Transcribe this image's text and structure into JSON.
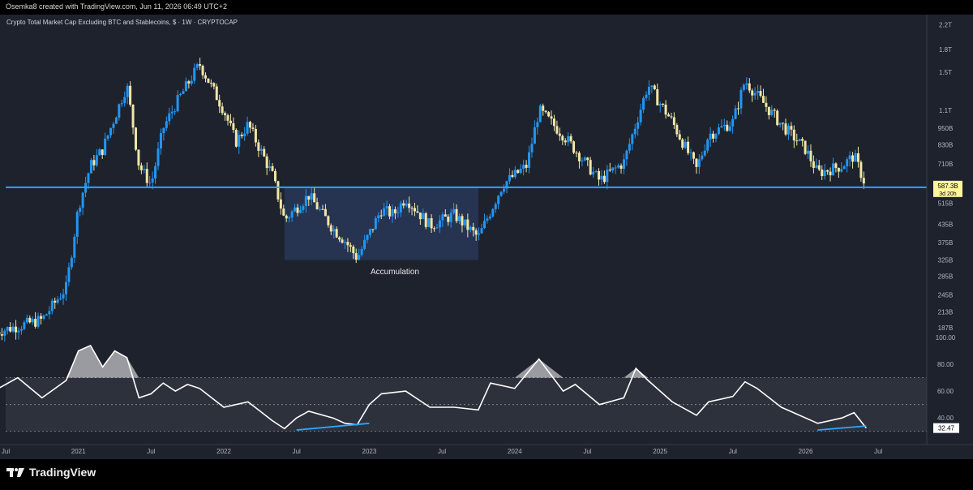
{
  "header": {
    "caption": "Osemka8 created with TradingView.com, Jun 11, 2026 06:49 UTC+2"
  },
  "chart_title": "Crypto Total Market Cap Excluding BTC and Stablecoins, $ · 1W · CRYPTOCAP",
  "footer": {
    "brand": "TradingView",
    "logo_icon": "tradingview-logo-icon"
  },
  "colors": {
    "background": "#1e222d",
    "up": "#2196f3",
    "down": "#f0e6a6",
    "support_line": "#2ba5ff",
    "rsi_line": "#ffffff",
    "zone": "#2a3a5e",
    "price_badge": "#fff59d"
  },
  "annotations": {
    "zone_label": "Accumulation"
  },
  "price_axis": {
    "ticks": [
      "2.2T",
      "1.8T",
      "1.5T",
      "1.1T",
      "950B",
      "830B",
      "710B",
      "515B",
      "435B",
      "375B",
      "325B",
      "285B",
      "245B",
      "213B",
      "187B"
    ]
  },
  "price_badge": {
    "value": "587.3B",
    "countdown": "3d 20h"
  },
  "rsi_axis": {
    "ticks": [
      "100.00",
      "80.00",
      "60.00",
      "40.00"
    ],
    "current": "32.47"
  },
  "time_axis": {
    "labels": [
      "Jul",
      "2021",
      "Jul",
      "2022",
      "Jul",
      "2023",
      "Jul",
      "2024",
      "Jul",
      "2025",
      "Jul",
      "2026",
      "Jul"
    ]
  },
  "chart_data": {
    "type": "candlestick",
    "title": "Crypto Total Market Cap Excluding BTC and Stablecoins, $ · 1W · CRYPTOCAP",
    "y_scale": "log",
    "ylim": [
      180,
      2300
    ],
    "unit": "B USD",
    "support_level": 587.3,
    "accumulation_zone": {
      "from": "2022-06",
      "to": "2023-10",
      "low": 325,
      "high": 587.3
    },
    "close_path": [
      {
        "date": "2020-06",
        "value": 180
      },
      {
        "date": "2020-10",
        "value": 200
      },
      {
        "date": "2020-12",
        "value": 260
      },
      {
        "date": "2021-01",
        "value": 500
      },
      {
        "date": "2021-02",
        "value": 700
      },
      {
        "date": "2021-03",
        "value": 800
      },
      {
        "date": "2021-05",
        "value": 1350
      },
      {
        "date": "2021-06",
        "value": 700
      },
      {
        "date": "2021-07",
        "value": 600
      },
      {
        "date": "2021-08",
        "value": 950
      },
      {
        "date": "2021-09",
        "value": 1150
      },
      {
        "date": "2021-11",
        "value": 1600
      },
      {
        "date": "2022-01",
        "value": 1100
      },
      {
        "date": "2022-02",
        "value": 850
      },
      {
        "date": "2022-03",
        "value": 980
      },
      {
        "date": "2022-05",
        "value": 650
      },
      {
        "date": "2022-06",
        "value": 450
      },
      {
        "date": "2022-08",
        "value": 550
      },
      {
        "date": "2022-10",
        "value": 420
      },
      {
        "date": "2022-11",
        "value": 380
      },
      {
        "date": "2022-12",
        "value": 330
      },
      {
        "date": "2023-02",
        "value": 490
      },
      {
        "date": "2023-03",
        "value": 470
      },
      {
        "date": "2023-04",
        "value": 540
      },
      {
        "date": "2023-06",
        "value": 430
      },
      {
        "date": "2023-08",
        "value": 470
      },
      {
        "date": "2023-10",
        "value": 390
      },
      {
        "date": "2023-12",
        "value": 600
      },
      {
        "date": "2024-02",
        "value": 700
      },
      {
        "date": "2024-03",
        "value": 1100
      },
      {
        "date": "2024-05",
        "value": 900
      },
      {
        "date": "2024-08",
        "value": 620
      },
      {
        "date": "2024-10",
        "value": 720
      },
      {
        "date": "2024-12",
        "value": 1350
      },
      {
        "date": "2025-02",
        "value": 1000
      },
      {
        "date": "2025-04",
        "value": 680
      },
      {
        "date": "2025-05",
        "value": 900
      },
      {
        "date": "2025-07",
        "value": 1000
      },
      {
        "date": "2025-08",
        "value": 1400
      },
      {
        "date": "2025-10",
        "value": 1100
      },
      {
        "date": "2025-11",
        "value": 980
      },
      {
        "date": "2026-01",
        "value": 800
      },
      {
        "date": "2026-02",
        "value": 660
      },
      {
        "date": "2026-04",
        "value": 700
      },
      {
        "date": "2026-05",
        "value": 760
      },
      {
        "date": "2026-06",
        "value": 590
      }
    ],
    "rsi": {
      "ylim": [
        25,
        100
      ],
      "band": [
        30,
        70
      ],
      "midline": 50,
      "values": [
        {
          "date": "2020-06",
          "value": 60
        },
        {
          "date": "2020-08",
          "value": 70
        },
        {
          "date": "2020-10",
          "value": 55
        },
        {
          "date": "2020-12",
          "value": 68
        },
        {
          "date": "2021-01",
          "value": 90
        },
        {
          "date": "2021-02",
          "value": 94
        },
        {
          "date": "2021-03",
          "value": 78
        },
        {
          "date": "2021-04",
          "value": 90
        },
        {
          "date": "2021-05",
          "value": 85
        },
        {
          "date": "2021-06",
          "value": 55
        },
        {
          "date": "2021-07",
          "value": 58
        },
        {
          "date": "2021-08",
          "value": 66
        },
        {
          "date": "2021-09",
          "value": 60
        },
        {
          "date": "2021-10",
          "value": 65
        },
        {
          "date": "2021-11",
          "value": 62
        },
        {
          "date": "2021-12",
          "value": 55
        },
        {
          "date": "2022-01",
          "value": 48
        },
        {
          "date": "2022-03",
          "value": 52
        },
        {
          "date": "2022-04",
          "value": 45
        },
        {
          "date": "2022-05",
          "value": 38
        },
        {
          "date": "2022-06",
          "value": 32
        },
        {
          "date": "2022-07",
          "value": 40
        },
        {
          "date": "2022-08",
          "value": 45
        },
        {
          "date": "2022-10",
          "value": 40
        },
        {
          "date": "2022-11",
          "value": 36
        },
        {
          "date": "2022-12",
          "value": 35
        },
        {
          "date": "2023-01",
          "value": 50
        },
        {
          "date": "2023-02",
          "value": 58
        },
        {
          "date": "2023-04",
          "value": 60
        },
        {
          "date": "2023-06",
          "value": 48
        },
        {
          "date": "2023-08",
          "value": 48
        },
        {
          "date": "2023-10",
          "value": 46
        },
        {
          "date": "2023-11",
          "value": 66
        },
        {
          "date": "2024-01",
          "value": 62
        },
        {
          "date": "2024-03",
          "value": 84
        },
        {
          "date": "2024-05",
          "value": 60
        },
        {
          "date": "2024-06",
          "value": 65
        },
        {
          "date": "2024-08",
          "value": 50
        },
        {
          "date": "2024-10",
          "value": 55
        },
        {
          "date": "2024-11",
          "value": 77
        },
        {
          "date": "2024-12",
          "value": 68
        },
        {
          "date": "2025-02",
          "value": 52
        },
        {
          "date": "2025-04",
          "value": 42
        },
        {
          "date": "2025-05",
          "value": 52
        },
        {
          "date": "2025-07",
          "value": 56
        },
        {
          "date": "2025-08",
          "value": 67
        },
        {
          "date": "2025-09",
          "value": 62
        },
        {
          "date": "2025-10",
          "value": 55
        },
        {
          "date": "2025-11",
          "value": 48
        },
        {
          "date": "2025-12",
          "value": 44
        },
        {
          "date": "2026-02",
          "value": 36
        },
        {
          "date": "2026-04",
          "value": 40
        },
        {
          "date": "2026-05",
          "value": 44
        },
        {
          "date": "2026-06",
          "value": 32.47
        }
      ]
    },
    "divergence_lines": [
      {
        "from": {
          "date": "2022-07",
          "value": 31
        },
        "to": {
          "date": "2023-01",
          "value": 36
        }
      },
      {
        "from": {
          "date": "2026-02",
          "value": 31
        },
        "to": {
          "date": "2026-06",
          "value": 34
        }
      }
    ]
  }
}
